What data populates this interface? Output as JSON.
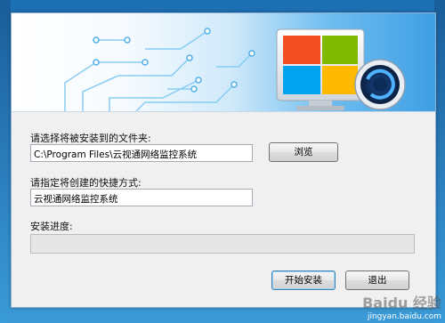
{
  "installer": {
    "folder_label": "请选择将被安装到的文件夹:",
    "folder_value": "C:\\Program Files\\云视通网络监控系统",
    "browse_label": "浏览",
    "shortcut_label": "请指定将创建的快捷方式:",
    "shortcut_value": "云视通网络监控系统",
    "progress_label": "安装进度:",
    "progress_fraction": 0,
    "install_button": "开始安装",
    "exit_button": "退出"
  },
  "watermark": {
    "logo_text": "Baidu 经验",
    "url": "jingyan.baidu.com"
  },
  "colors": {
    "banner_blue": "#3e9fe4",
    "logo_orange": "#f25022",
    "logo_green": "#7fba00",
    "logo_blue": "#00a4ef",
    "logo_yellow": "#ffb900",
    "progress_green": "#06b025"
  }
}
